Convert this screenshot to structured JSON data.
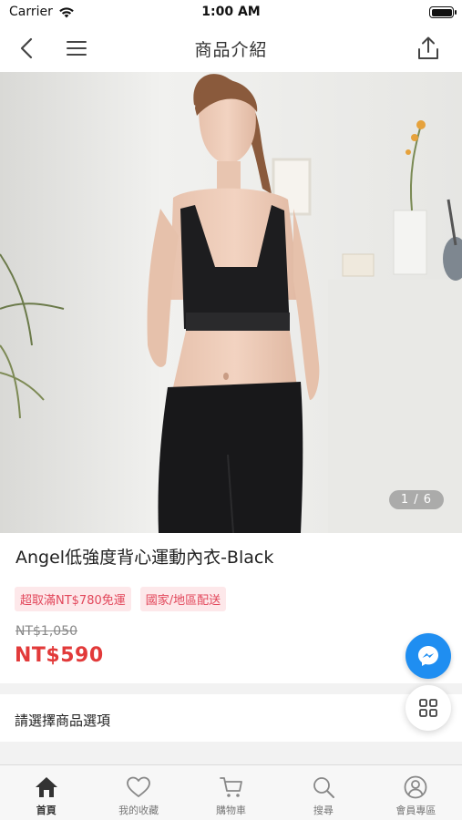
{
  "status_bar": {
    "carrier": "Carrier",
    "time": "1:00 AM"
  },
  "header": {
    "title": "商品介紹",
    "icons": [
      "back-icon",
      "menu-icon",
      "share-icon"
    ]
  },
  "gallery": {
    "pager": "1 / 6"
  },
  "product": {
    "title": "Angel低強度背心運動內衣-Black",
    "tags": [
      "超取滿NT$780免運",
      "國家/地區配送"
    ],
    "original_price": "NT$1,050",
    "sale_price": "NT$590"
  },
  "options": {
    "label": "請選擇商品選項"
  },
  "floating": {
    "icons": [
      "messenger-icon",
      "grid-icon"
    ]
  },
  "tabbar": {
    "items": [
      {
        "label": "首頁",
        "icon": "home-icon"
      },
      {
        "label": "我的收藏",
        "icon": "heart-icon"
      },
      {
        "label": "購物車",
        "icon": "cart-icon"
      },
      {
        "label": "搜尋",
        "icon": "search-icon"
      },
      {
        "label": "會員專區",
        "icon": "user-icon"
      }
    ],
    "active": "首頁"
  },
  "colors": {
    "accent_red": "#e23a3a",
    "tag_bg": "#fde8ea",
    "messenger_blue": "#1f8ef1"
  }
}
